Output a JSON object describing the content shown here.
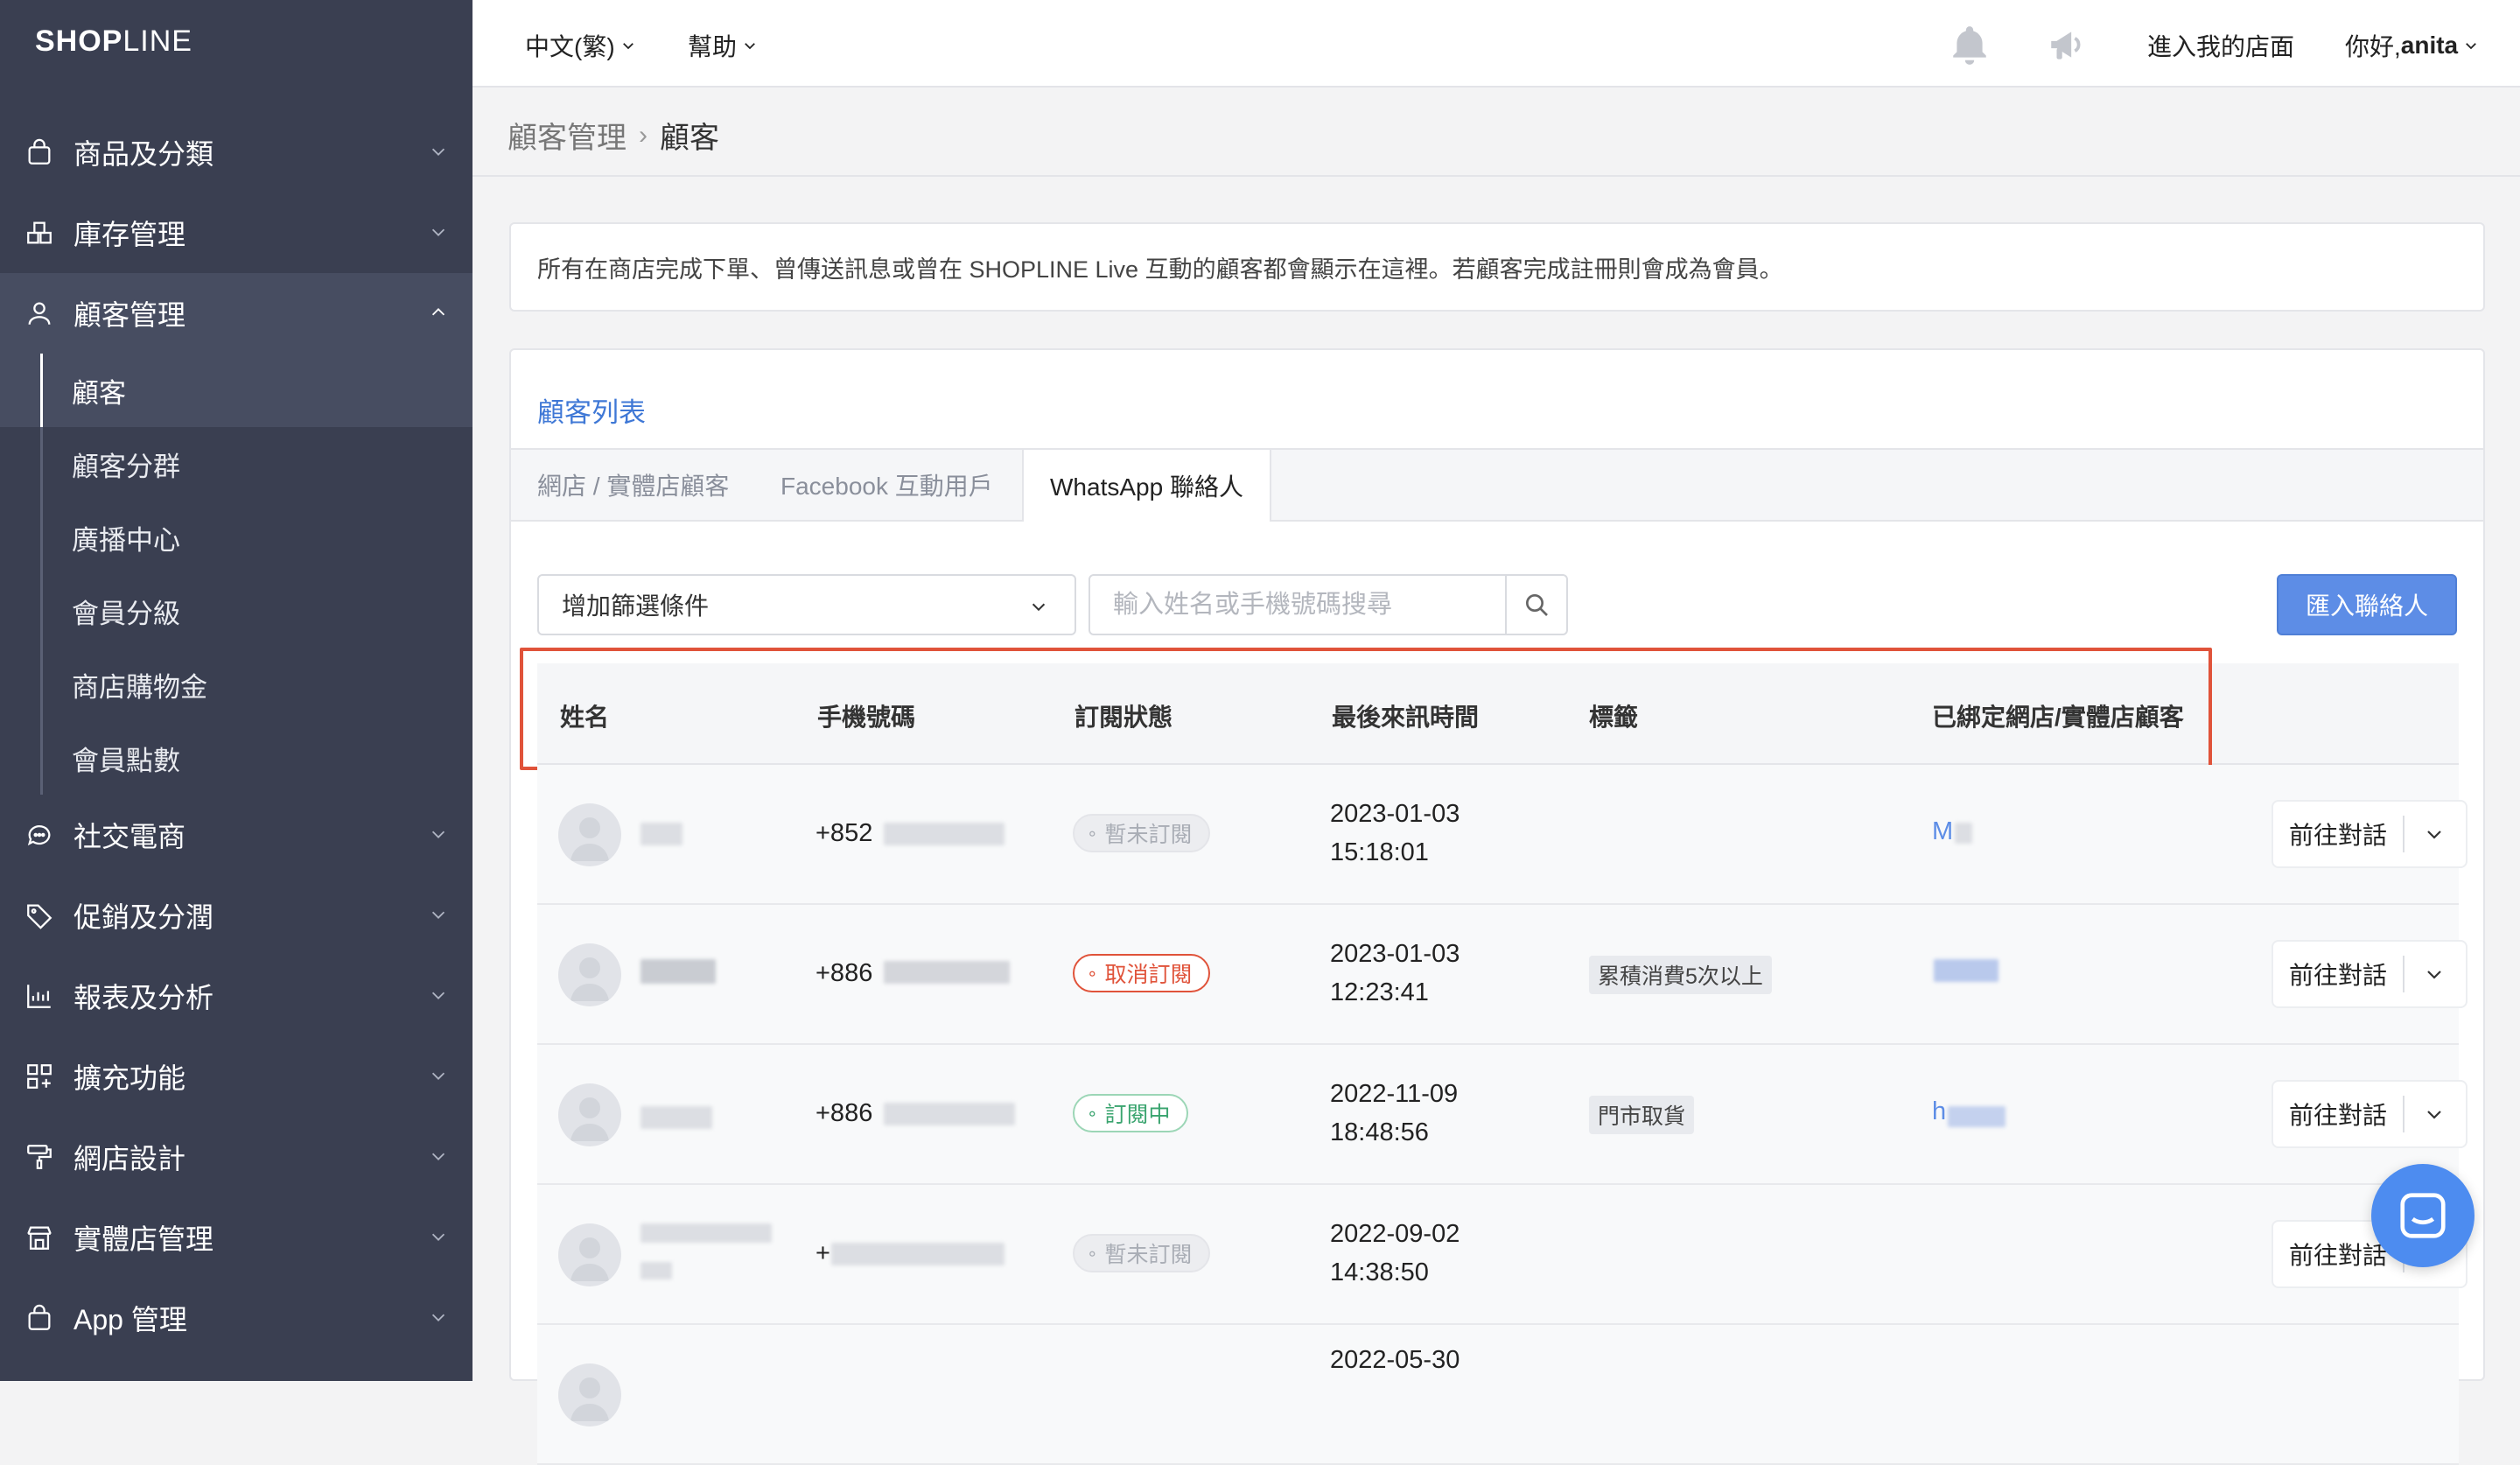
{
  "brand": {
    "logo_bold": "SHOP",
    "logo_light": "LINE"
  },
  "sidebar": {
    "items": [
      {
        "label": "商品及分類",
        "icon": "shopping-bag-icon"
      },
      {
        "label": "庫存管理",
        "icon": "inventory-icon"
      },
      {
        "label": "顧客管理",
        "icon": "user-icon"
      },
      {
        "label": "社交電商",
        "icon": "chat-icon"
      },
      {
        "label": "促銷及分潤",
        "icon": "tag-icon"
      },
      {
        "label": "報表及分析",
        "icon": "chart-icon"
      },
      {
        "label": "擴充功能",
        "icon": "grid-plus-icon"
      },
      {
        "label": "網店設計",
        "icon": "paint-roller-icon"
      },
      {
        "label": "實體店管理",
        "icon": "store-icon"
      },
      {
        "label": "App 管理",
        "icon": "shopping-bag-icon"
      }
    ],
    "sub_items": [
      "顧客",
      "顧客分群",
      "廣播中心",
      "會員分級",
      "商店購物金",
      "會員點數"
    ]
  },
  "topbar": {
    "language": "中文(繁)",
    "help": "幫助",
    "enter_store": "進入我的店面",
    "greeting": "你好, ",
    "username": "anita"
  },
  "breadcrumb": {
    "parent": "顧客管理",
    "separator": "›",
    "current": "顧客"
  },
  "info_text": "所有在商店完成下單、曾傳送訊息或曾在 SHOPLINE Live 互動的顧客都會顯示在這裡。若顧客完成註冊則會成為會員。",
  "panel": {
    "title": "顧客列表",
    "tabs": [
      "網店 / 實體店顧客",
      "Facebook 互動用戶",
      "WhatsApp 聯絡人"
    ],
    "active_tab": 2,
    "filter_label": "增加篩選條件",
    "search_placeholder": "輸入姓名或手機號碼搜尋",
    "import_label": "匯入聯絡人"
  },
  "table": {
    "columns": [
      "姓名",
      "手機號碼",
      "訂閱狀態",
      "最後來訊時間",
      "標籤",
      "已綁定網店/實體店顧客"
    ],
    "rows": [
      {
        "phone_prefix": "+852",
        "status": "暫未訂閱",
        "status_type": "gray",
        "date": "2023-01-03",
        "time": "15:18:01",
        "tag": "",
        "bound": "M"
      },
      {
        "phone_prefix": "+886",
        "status": "取消訂閱",
        "status_type": "red",
        "date": "2023-01-03",
        "time": "12:23:41",
        "tag": "累積消費5次以上",
        "bound": ""
      },
      {
        "phone_prefix": "+886",
        "status": "訂閱中",
        "status_type": "green",
        "date": "2022-11-09",
        "time": "18:48:56",
        "tag": "門市取貨",
        "bound": "h"
      },
      {
        "phone_prefix": "+",
        "status": "暫未訂閱",
        "status_type": "gray",
        "date": "2022-09-02",
        "time": "14:38:50",
        "tag": "",
        "bound": ""
      },
      {
        "phone_prefix": "",
        "status": "",
        "status_type": "gray",
        "date": "2022-05-30",
        "time": "",
        "tag": "",
        "bound": ""
      }
    ],
    "action_label": "前往對話"
  },
  "colors": {
    "sidebar_bg": "#3a3f51",
    "accent": "#5d8de6",
    "highlight": "#e0533a"
  }
}
